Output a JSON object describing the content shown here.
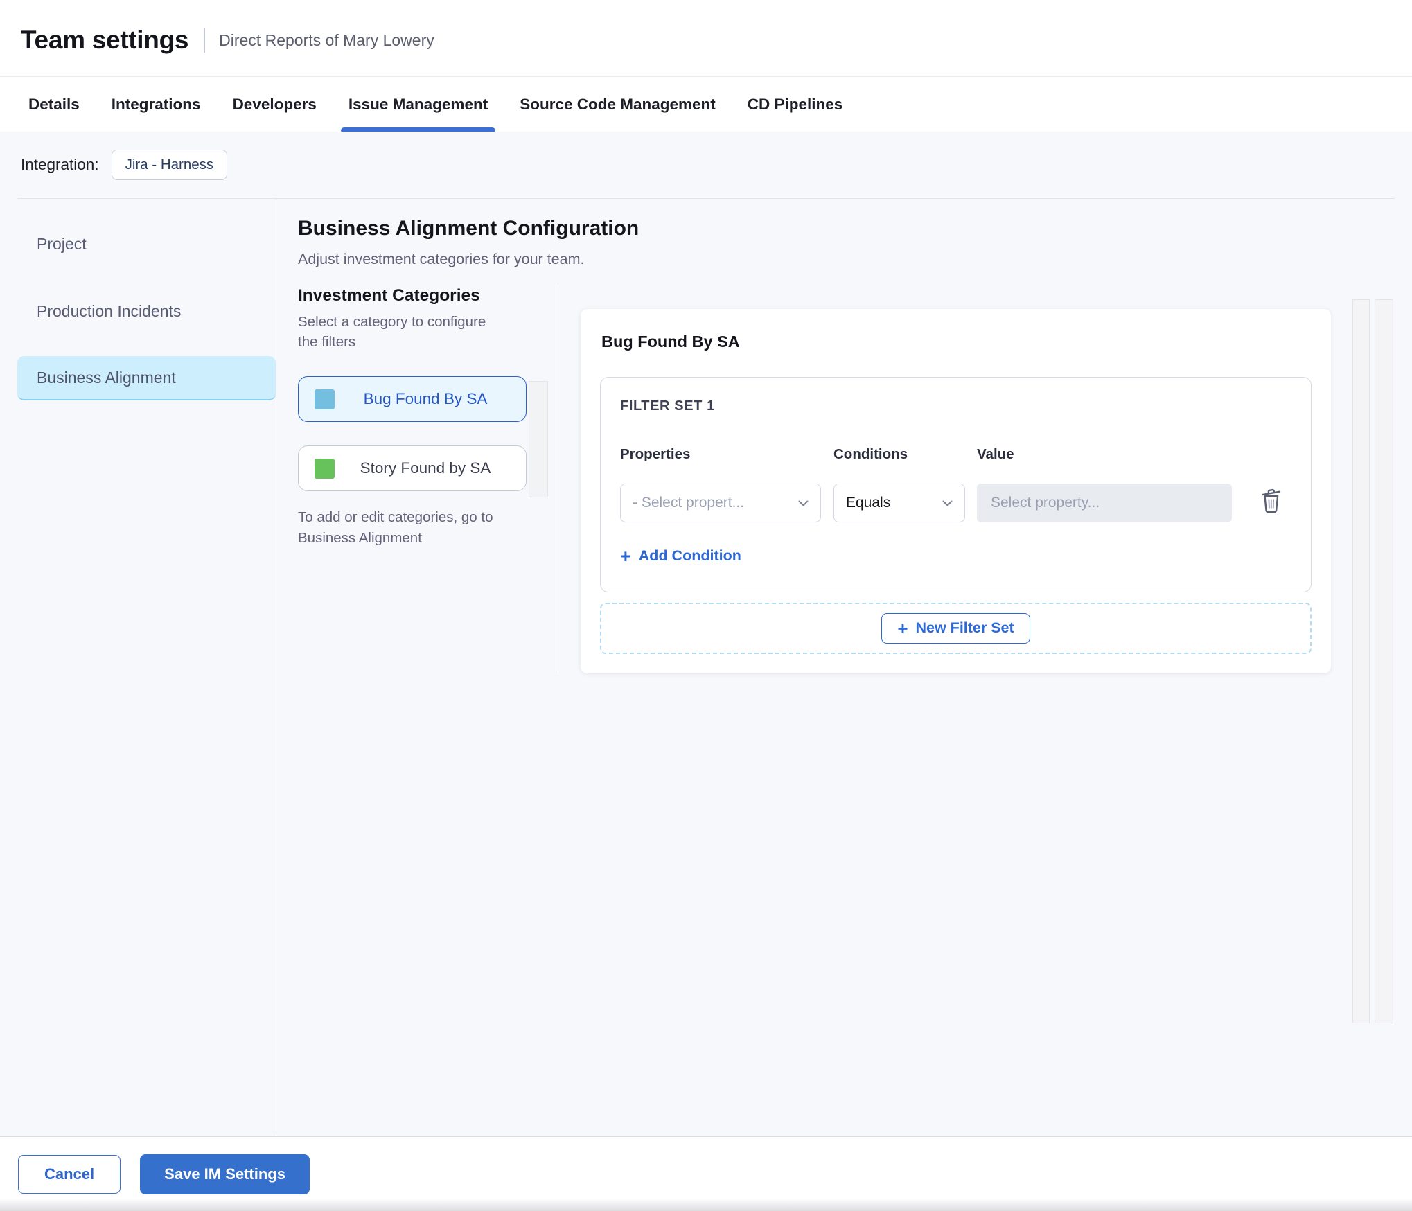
{
  "header": {
    "title": "Team settings",
    "subtitle": "Direct Reports of Mary Lowery"
  },
  "tabs": [
    {
      "label": "Details"
    },
    {
      "label": "Integrations"
    },
    {
      "label": "Developers"
    },
    {
      "label": "Issue Management"
    },
    {
      "label": "Source Code Management"
    },
    {
      "label": "CD Pipelines"
    }
  ],
  "integration": {
    "label": "Integration:",
    "chip": "Jira - Harness"
  },
  "sidebar": {
    "items": [
      {
        "label": "Project"
      },
      {
        "label": "Production Incidents"
      },
      {
        "label": "Business Alignment"
      }
    ]
  },
  "main": {
    "title": "Business Alignment Configuration",
    "subtitle": "Adjust investment categories for your team.",
    "categories": {
      "heading": "Investment Categories",
      "description": "Select a category to configure the filters",
      "items": [
        {
          "label": "Bug Found By SA",
          "swatch_color": "#74bfe0"
        },
        {
          "label": "Story Found by SA",
          "swatch_color": "#67c25b"
        }
      ],
      "note": "To add or edit categories, go to Business Alignment"
    },
    "panel": {
      "title": "Bug Found By SA",
      "filter_set_label": "FILTER SET 1",
      "columns": {
        "properties": "Properties",
        "conditions": "Conditions",
        "value": "Value"
      },
      "property_placeholder": "- Select propert...",
      "condition_value": "Equals",
      "value_placeholder": "Select property...",
      "add_condition_label": "Add Condition",
      "new_filter_set_label": "New Filter Set"
    }
  },
  "footer": {
    "cancel_label": "Cancel",
    "save_label": "Save IM Settings"
  },
  "icons": {
    "plus": "+"
  },
  "colors": {
    "accent": "#2d68d8",
    "active_tab_underline": "#3b6fd4",
    "save_button_bg": "#3570cd",
    "selected_sidebar_bg": "#cdeffd",
    "selected_category_bg": "#eaf6fd",
    "selected_category_border": "#2a62c9",
    "bug_swatch": "#74bfe0",
    "story_swatch": "#67c25b"
  }
}
